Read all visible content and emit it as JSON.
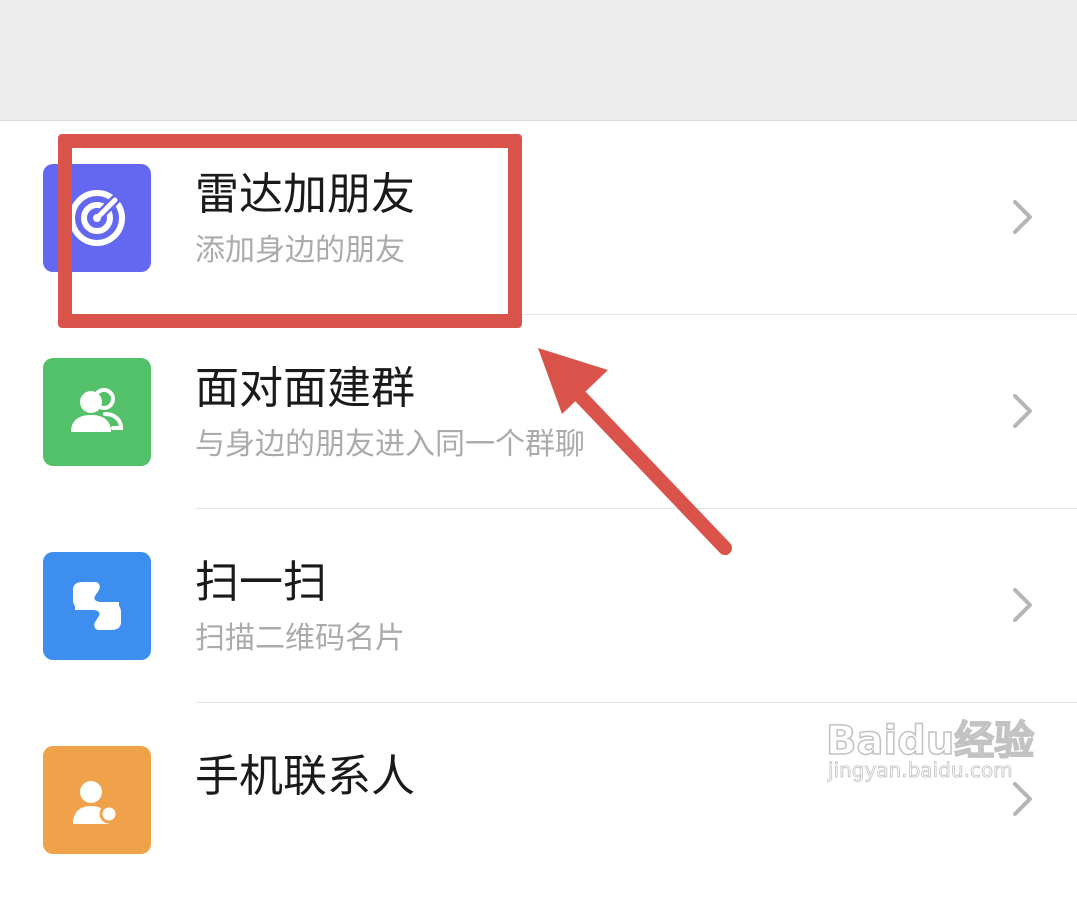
{
  "header": {
    "title_fragment": "········"
  },
  "items": [
    {
      "title": "雷达加朋友",
      "subtitle": "添加身边的朋友",
      "icon": "radar-icon",
      "color": "#6467f0"
    },
    {
      "title": "面对面建群",
      "subtitle": "与身边的朋友进入同一个群聊",
      "icon": "group-icon",
      "color": "#53c169"
    },
    {
      "title": "扫一扫",
      "subtitle": "扫描二维码名片",
      "icon": "scan-icon",
      "color": "#3e8ef0"
    },
    {
      "title": "手机联系人",
      "subtitle": "",
      "icon": "contact-icon",
      "color": "#f0a24b"
    }
  ],
  "annotation": {
    "color": "#d9534a"
  },
  "watermark": {
    "brand": "Baidu经验",
    "url": "jingyan.baidu.com"
  }
}
